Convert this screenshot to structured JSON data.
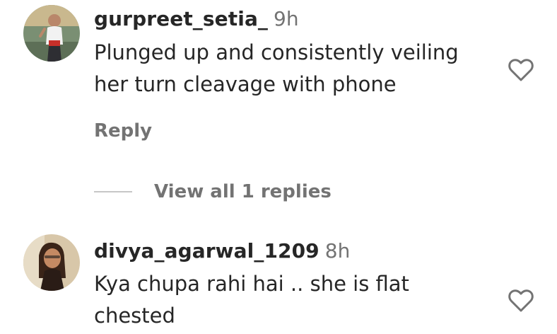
{
  "comments": [
    {
      "username": "gurpreet_setia_",
      "time": "9h",
      "text": "Plunged up and consistently veiling her turn cleavage with phone",
      "reply_label": "Reply",
      "view_replies_label": "View all 1 replies",
      "avatar_icon": "profile-photo"
    },
    {
      "username": "divya_agarwal_1209",
      "time": "8h",
      "text": "Kya chupa rahi hai .. she is flat chested",
      "avatar_icon": "profile-photo"
    }
  ],
  "icons": {
    "like": "heart-outline-icon"
  },
  "colors": {
    "username": "#262626",
    "secondary_text": "#737373",
    "divider": "#c7c7c7",
    "icon_stroke": "#737373"
  }
}
